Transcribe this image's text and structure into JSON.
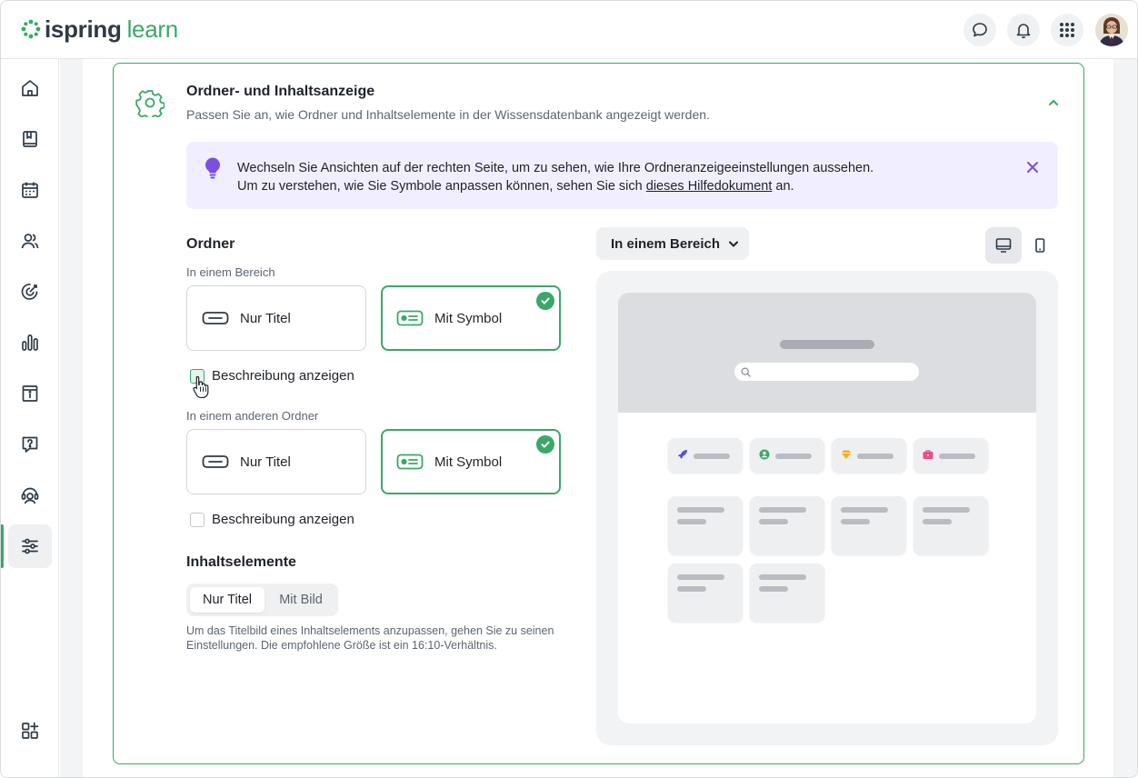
{
  "app": {
    "logo_primary": "ispring",
    "logo_secondary": "learn"
  },
  "colors": {
    "accent": "#3aa86a",
    "info_bg": "#f1efff",
    "bulb": "#7b4fe0",
    "text": "#1f2329",
    "muted": "#5d6570"
  },
  "header": {
    "icons": [
      "chat-icon",
      "bell-icon",
      "apps-grid-icon",
      "user-avatar"
    ]
  },
  "sidebar": {
    "items": [
      {
        "icon": "home-icon"
      },
      {
        "icon": "book-icon"
      },
      {
        "icon": "calendar-icon"
      },
      {
        "icon": "users-icon"
      },
      {
        "icon": "target-icon"
      },
      {
        "icon": "bar-chart-icon"
      },
      {
        "icon": "info-board-icon"
      },
      {
        "icon": "question-chat-icon"
      },
      {
        "icon": "support-agent-icon"
      },
      {
        "icon": "settings-sliders-icon",
        "active": true
      },
      {
        "icon": "add-apps-icon"
      }
    ]
  },
  "section": {
    "title": "Ordner- und Inhaltsanzeige",
    "subtitle": "Passen Sie an, wie Ordner und Inhaltselemente in der Wissensdatenbank angezeigt werden."
  },
  "info": {
    "line1": "Wechseln Sie Ansichten auf der rechten Seite, um zu sehen, wie Ihre Ordneranzeigeeinstellungen aussehen.",
    "line2_before": "Um zu verstehen, wie Sie Symbole anpassen können, sehen Sie sich ",
    "link": "dieses Hilfedokument",
    "line2_after": " an."
  },
  "folders": {
    "heading": "Ordner",
    "group1": {
      "label": "In einem Bereich",
      "option_title_only": "Nur Titel",
      "option_with_icon": "Mit Symbol",
      "selected": "Mit Symbol",
      "checkbox": "Beschreibung anzeigen"
    },
    "group2": {
      "label": "In einem anderen Ordner",
      "option_title_only": "Nur Titel",
      "option_with_icon": "Mit Symbol",
      "selected": "Mit Symbol",
      "checkbox": "Beschreibung anzeigen"
    }
  },
  "content_items": {
    "heading": "Inhaltselemente",
    "seg_title_only": "Nur Titel",
    "seg_with_image": "Mit Bild",
    "selected": "Nur Titel",
    "hint": "Um das Titelbild eines Inhaltselements anzupassen, gehen Sie zu seinen Einstellungen. Die empfohlene Größe ist ein 16:10-Verhältnis."
  },
  "preview": {
    "view_select": "In einem Bereich",
    "device": "desktop",
    "pill_icons": [
      {
        "icon": "rocket-icon",
        "color": "#5b4fe0"
      },
      {
        "icon": "person-icon",
        "color": "#3aa86a"
      },
      {
        "icon": "diamond-icon",
        "color": "#f2b01e"
      },
      {
        "icon": "briefcase-icon",
        "color": "#e94e8a"
      }
    ],
    "tile_count": 6
  }
}
